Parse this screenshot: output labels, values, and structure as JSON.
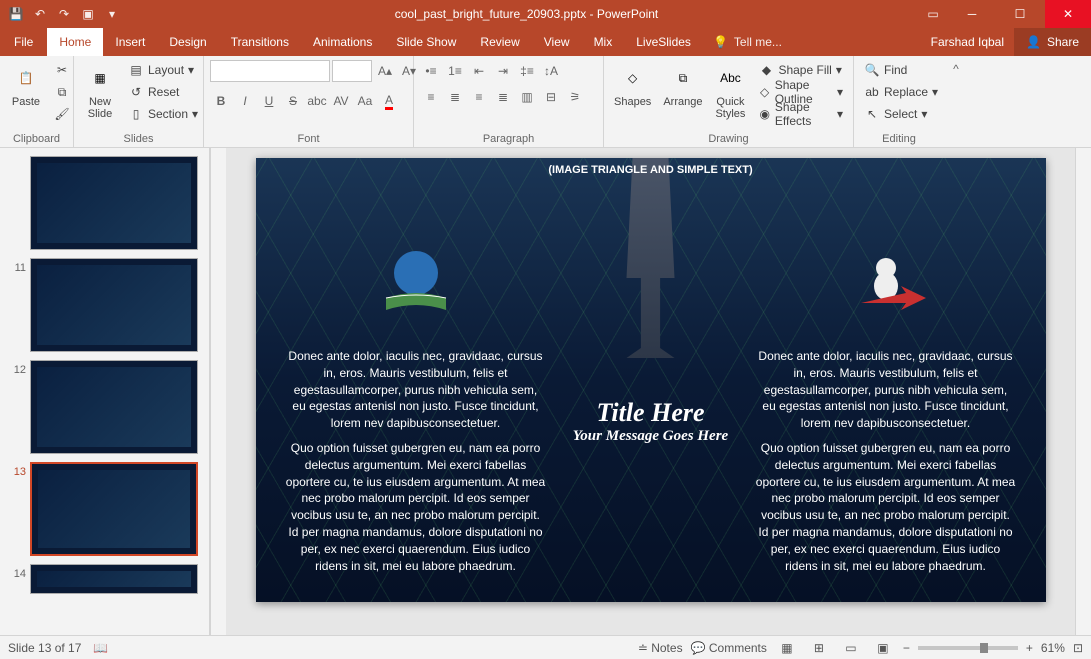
{
  "title": "cool_past_bright_future_20903.pptx - PowerPoint",
  "user": "Farshad Iqbal",
  "share": "Share",
  "tabs": {
    "file": "File",
    "home": "Home",
    "insert": "Insert",
    "design": "Design",
    "transitions": "Transitions",
    "animations": "Animations",
    "slideshow": "Slide Show",
    "review": "Review",
    "view": "View",
    "mix": "Mix",
    "liveslides": "LiveSlides",
    "tellme": "Tell me..."
  },
  "ribbon": {
    "clipboard": {
      "label": "Clipboard",
      "paste": "Paste"
    },
    "slides": {
      "label": "Slides",
      "newslide": "New\nSlide",
      "layout": "Layout",
      "reset": "Reset",
      "section": "Section"
    },
    "font": {
      "label": "Font"
    },
    "paragraph": {
      "label": "Paragraph"
    },
    "drawing": {
      "label": "Drawing",
      "shapes": "Shapes",
      "arrange": "Arrange",
      "quick": "Quick\nStyles",
      "fill": "Shape Fill",
      "outline": "Shape Outline",
      "effects": "Shape Effects"
    },
    "editing": {
      "label": "Editing",
      "find": "Find",
      "replace": "Replace",
      "select": "Select"
    }
  },
  "slide": {
    "header": "(IMAGE TRIANGLE AND SIMPLE TEXT)",
    "title": "Title Here",
    "subtitle": "Your Message  Goes Here",
    "para1": "Donec ante dolor, iaculis nec, gravidaac, cursus in, eros. Mauris vestibulum, felis et egestasullamcorper, purus nibh vehicula sem, eu egestas antenisl non justo. Fusce tincidunt, lorem nev dapibusconsectetuer.",
    "para2": "Quo option fuisset gubergren eu, nam ea porro delectus argumentum. Mei exerci fabellas oportere cu, te ius eiusdem argumentum. At mea nec probo malorum percipit. Id eos semper vocibus usu te, an nec probo malorum percipit. Id per magna mandamus, dolore disputationi no per, ex nec exerci quaerendum. Eius iudico ridens in sit, mei eu labore phaedrum."
  },
  "thumbs": [
    "11",
    "12",
    "13",
    "14"
  ],
  "status": {
    "slide": "Slide 13 of 17",
    "notes": "Notes",
    "comments": "Comments",
    "zoom": "61%"
  }
}
